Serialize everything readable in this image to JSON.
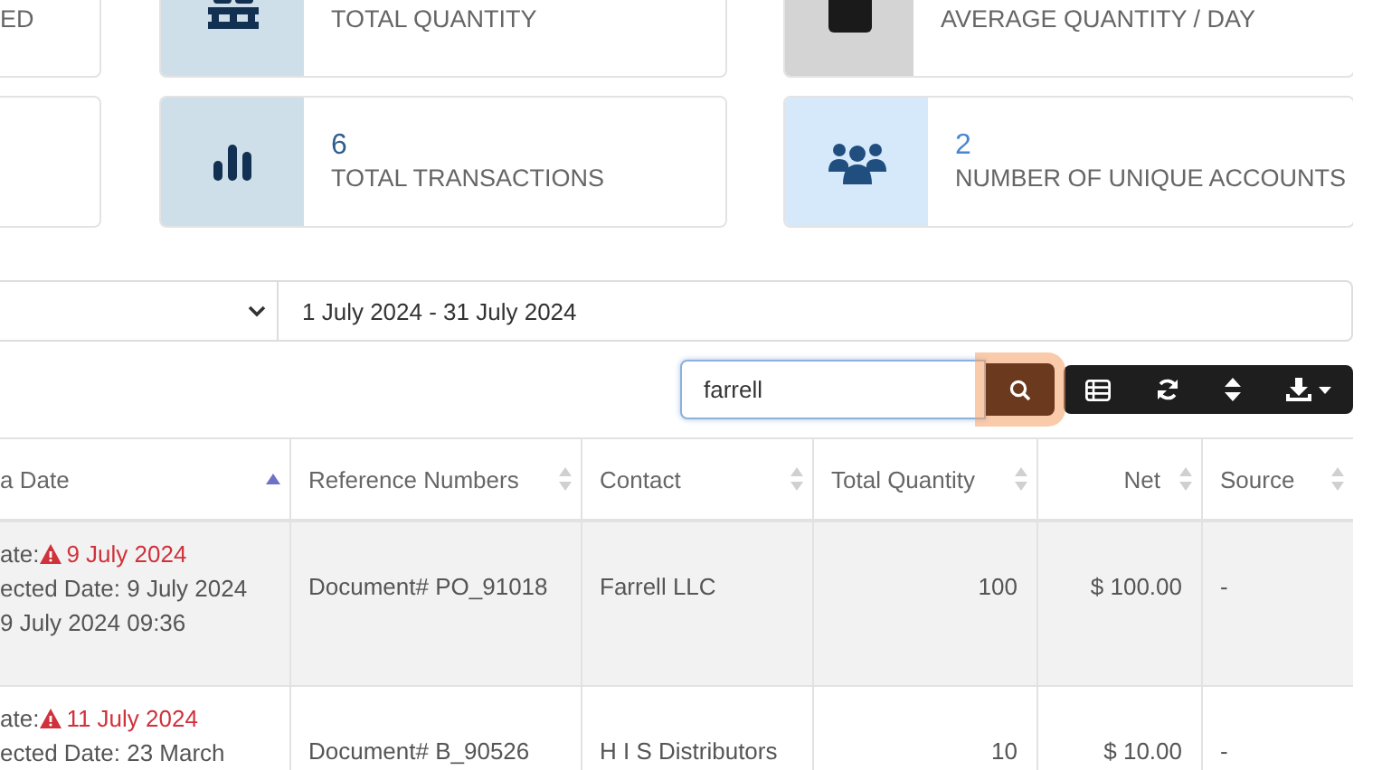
{
  "stats": [
    {
      "kind": "blank",
      "label": "ED"
    },
    {
      "kind": "pallet",
      "label": "TOTAL QUANTITY"
    },
    {
      "kind": "box",
      "label": "AVERAGE QUANTITY / DAY"
    },
    {
      "kind": "blank"
    },
    {
      "kind": "bars",
      "value": "6",
      "label": "TOTAL TRANSACTIONS"
    },
    {
      "kind": "users",
      "value": "2",
      "label": "NUMBER OF UNIQUE ACCOUNTS"
    }
  ],
  "filters": {
    "date_range": "1 July 2024 - 31 July 2024"
  },
  "search": {
    "value": "farrell"
  },
  "table": {
    "columns": [
      {
        "label": "a Date",
        "sorted": true
      },
      {
        "label": "Reference Numbers",
        "sorted": false
      },
      {
        "label": "Contact",
        "sorted": false
      },
      {
        "label": "Total Quantity",
        "sorted": false
      },
      {
        "label": "Net",
        "sorted": false
      },
      {
        "label": "Source",
        "sorted": false
      }
    ],
    "rows": [
      {
        "selected": true,
        "due_label": "ate:",
        "due_date": "9 July 2024",
        "overdue": true,
        "date_lines": [
          "ected Date: 9 July 2024",
          "9 July 2024 09:36"
        ],
        "reference": "Document# PO_91018",
        "contact": "Farrell LLC",
        "quantity": "100",
        "net": "$ 100.00",
        "source": "-"
      },
      {
        "selected": false,
        "due_label": "ate:",
        "due_date": "11 July 2024",
        "overdue": true,
        "date_lines": [
          "ected Date: 23 March"
        ],
        "reference": "Document# B_90526",
        "contact": "H I S Distributors",
        "quantity": "10",
        "net": "$ 10.00",
        "source": "-"
      }
    ]
  }
}
